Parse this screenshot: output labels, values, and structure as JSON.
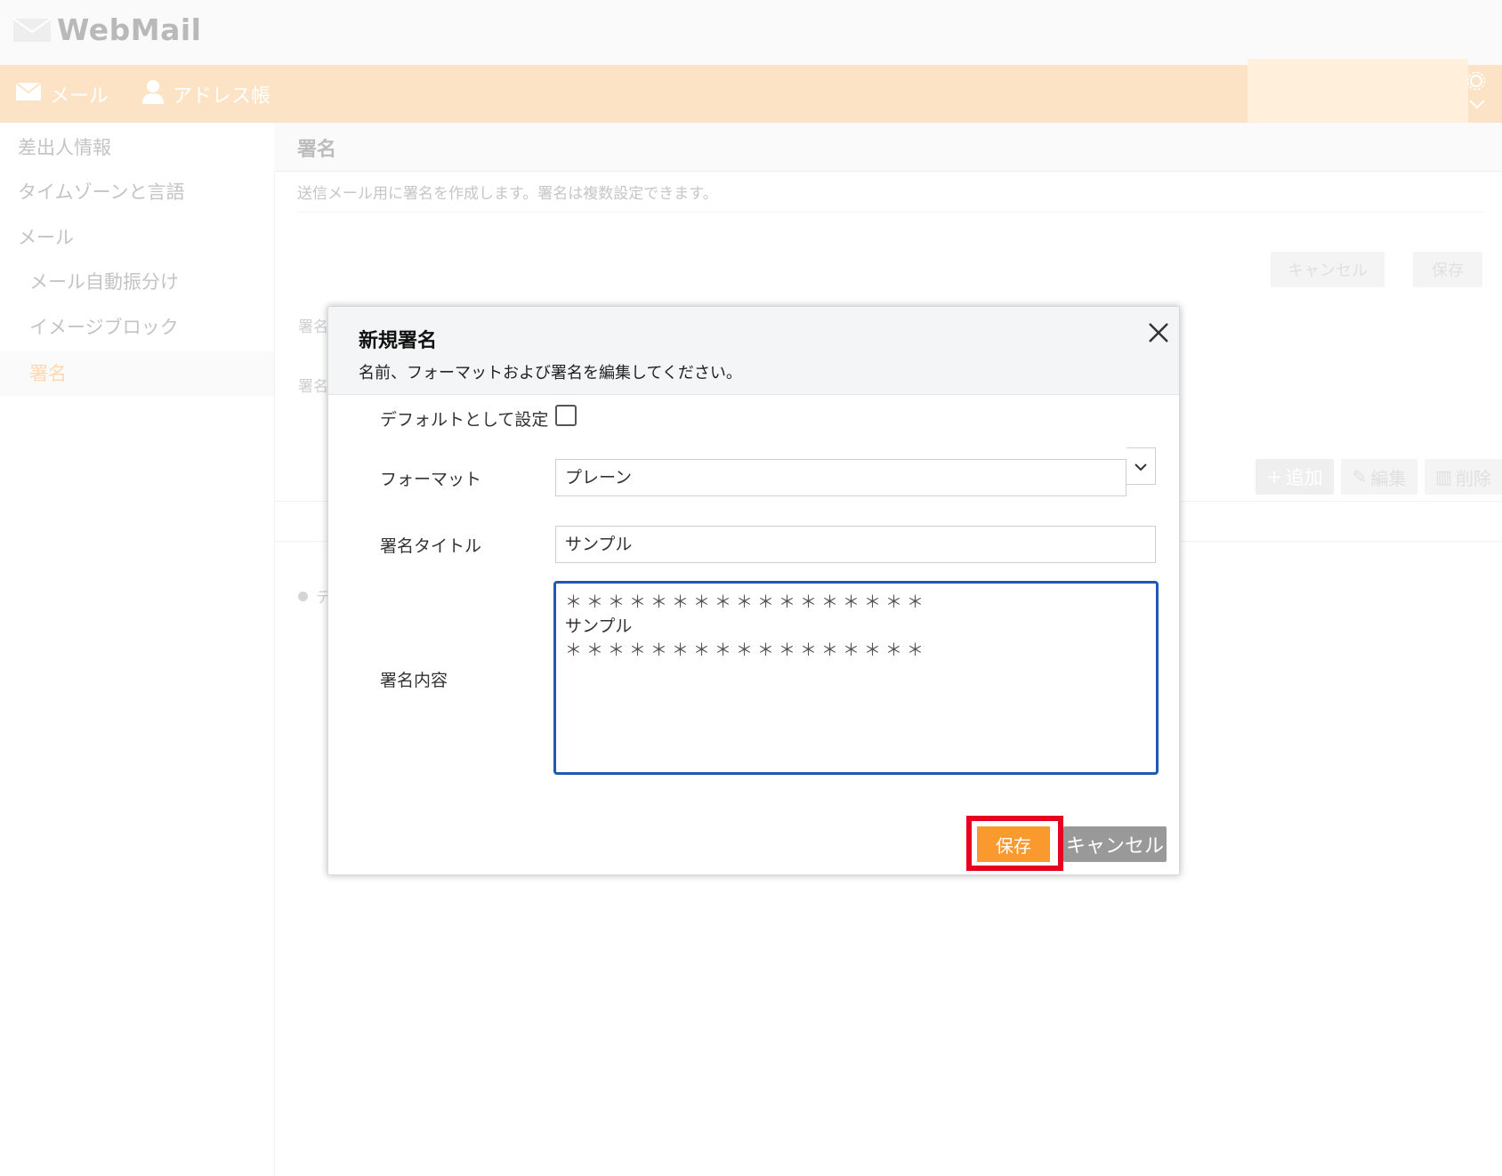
{
  "app": {
    "logo_text": "WebMail"
  },
  "nav": {
    "mail_label": "メール",
    "address_label": "アドレス帳"
  },
  "sidebar": {
    "items": [
      {
        "label": "差出人情報"
      },
      {
        "label": "タイムゾーンと言語"
      },
      {
        "label": "メール"
      },
      {
        "label": "メール自動振分け"
      },
      {
        "label": "イメージブロック"
      },
      {
        "label": "署名"
      }
    ]
  },
  "main": {
    "title": "署名",
    "description": "送信メール用に署名を作成します。署名は複数設定できます。",
    "cancel_label": "キャンセル",
    "save_label": "保存",
    "label_1": "署名",
    "label_2": "署名",
    "add_label": "追加",
    "edit_label": "編集",
    "delete_label": "削除",
    "list_item": "デ"
  },
  "modal": {
    "title": "新規署名",
    "subtitle": "名前、フォーマットおよび署名を編集してください。",
    "default_label": "デフォルトとして設定",
    "default_checked": false,
    "format_label": "フォーマット",
    "format_value": "プレーン",
    "title_label": "署名タイトル",
    "title_value": "サンプル",
    "content_label": "署名内容",
    "content_lines": [
      "＊＊＊＊＊＊＊＊＊＊＊＊＊＊＊＊＊",
      "サンプル",
      "＊＊＊＊＊＊＊＊＊＊＊＊＊＊＊＊＊"
    ],
    "save_label": "保存",
    "cancel_label": "キャンセル"
  },
  "colors": {
    "accent": "#fa9a2e",
    "nav_bg": "#fde3c5",
    "highlight": "#e8001f",
    "textarea_focus": "#2159b2"
  }
}
